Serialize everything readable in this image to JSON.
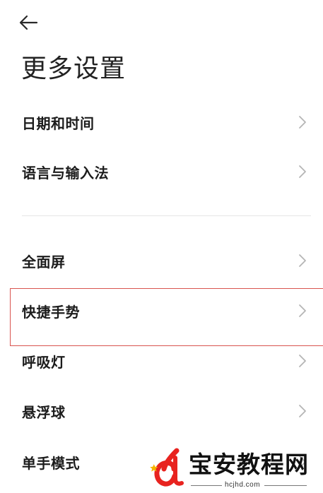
{
  "header": {
    "back_icon": "arrow-left-icon",
    "title": "更多设置"
  },
  "settings": {
    "group1": [
      {
        "label": "日期和时间",
        "icon": "chevron-right-icon"
      },
      {
        "label": "语言与输入法",
        "icon": "chevron-right-icon"
      }
    ],
    "group2": [
      {
        "label": "全面屏",
        "icon": "chevron-right-icon"
      },
      {
        "label": "快捷手势",
        "icon": "chevron-right-icon",
        "highlighted": true
      },
      {
        "label": "呼吸灯",
        "icon": "chevron-right-icon"
      },
      {
        "label": "悬浮球",
        "icon": "chevron-right-icon"
      },
      {
        "label": "单手模式",
        "icon": "chevron-right-icon"
      }
    ]
  },
  "watermark": {
    "brand": "宝安教程网",
    "url": "hcjhd.com",
    "colors": {
      "red": "#e8231f",
      "yellow": "#f5b400",
      "text": "#111111"
    }
  },
  "colors": {
    "highlight_border": "#d9544f",
    "divider": "#e6e6e6",
    "chevron": "#b5b5b5"
  }
}
